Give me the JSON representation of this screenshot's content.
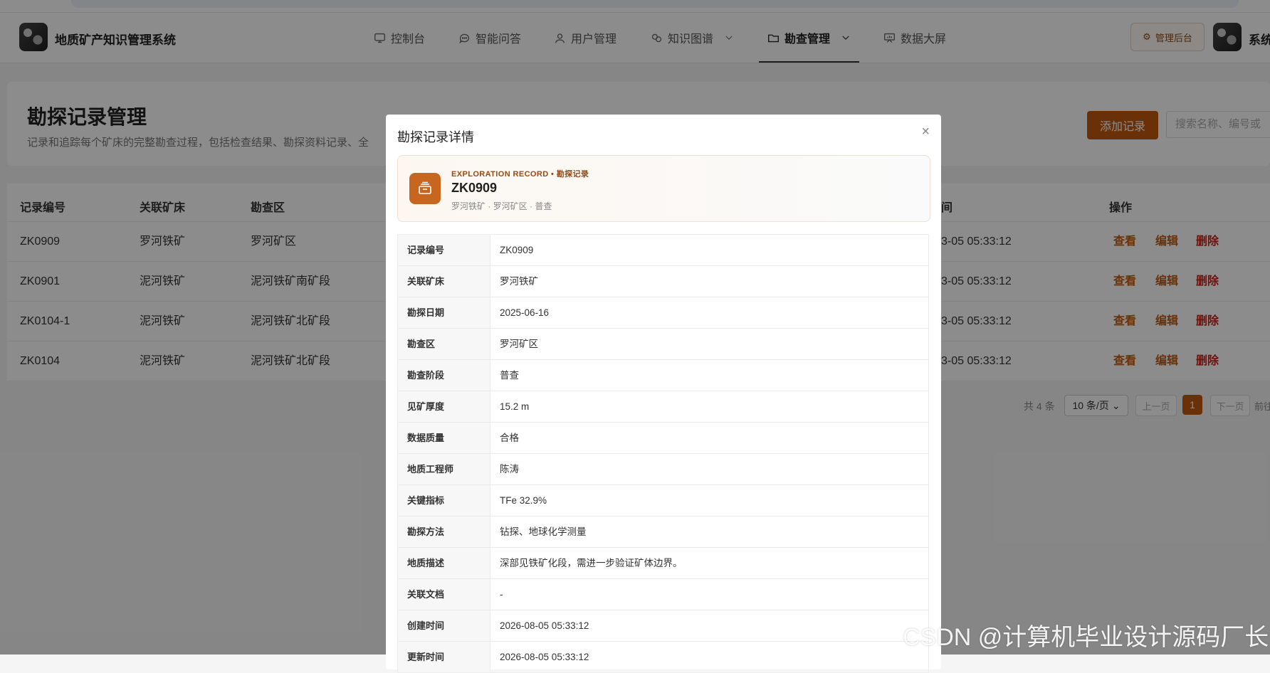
{
  "app": {
    "brand": "地质矿产知识管理系统",
    "admin_label": "管理后台",
    "system_name": "系统"
  },
  "nav": {
    "items": [
      {
        "label": "控制台",
        "icon": "monitor-icon"
      },
      {
        "label": "智能问答",
        "icon": "chat-icon"
      },
      {
        "label": "用户管理",
        "icon": "user-icon"
      },
      {
        "label": "知识图谱",
        "icon": "graph-icon"
      },
      {
        "label": "勘查管理",
        "icon": "folder-icon"
      },
      {
        "label": "数据大屏",
        "icon": "dashboard-icon"
      }
    ],
    "active": "勘查管理"
  },
  "page": {
    "title": "勘探记录管理",
    "description": "记录和追踪每个矿床的完整勘查过程，包括检查结果、勘探资料记录、全",
    "add_button": "添加记录",
    "search_placeholder": "搜索名称、编号或"
  },
  "table": {
    "headers": [
      "记录编号",
      "关联矿床",
      "勘查区",
      "间",
      "操作"
    ],
    "rows": [
      {
        "code": "ZK0909",
        "deposit": "罗河铁矿",
        "area": "罗河矿区",
        "time": "3-05 05:33:12"
      },
      {
        "code": "ZK0901",
        "deposit": "泥河铁矿",
        "area": "泥河铁矿南矿段",
        "time": "3-05 05:33:12"
      },
      {
        "code": "ZK0104-1",
        "deposit": "泥河铁矿",
        "area": "泥河铁矿北矿段",
        "time": "3-05 05:33:12"
      },
      {
        "code": "ZK0104",
        "deposit": "泥河铁矿",
        "area": "泥河铁矿北矿段",
        "time": "3-05 05:33:12"
      }
    ],
    "actions": {
      "view": "查看",
      "edit": "编辑",
      "delete": "删除"
    }
  },
  "pagination": {
    "total": "共 4 条",
    "page_size": "10 条/页",
    "prev": "上一页",
    "current": "1",
    "next": "下一页",
    "jump": "前往"
  },
  "modal": {
    "title": "勘探记录详情",
    "close": "×",
    "kicker": "EXPLORATION RECORD • 勘探记录",
    "code": "ZK0909",
    "subtitle": "罗河铁矿 · 罗河矿区 · 普查",
    "fields": [
      {
        "label": "记录编号",
        "value": "ZK0909"
      },
      {
        "label": "关联矿床",
        "value": "罗河铁矿"
      },
      {
        "label": "勘探日期",
        "value": "2025-06-16"
      },
      {
        "label": "勘查区",
        "value": "罗河矿区"
      },
      {
        "label": "勘查阶段",
        "value": "普查"
      },
      {
        "label": "见矿厚度",
        "value": "15.2 m"
      },
      {
        "label": "数据质量",
        "value": "合格"
      },
      {
        "label": "地质工程师",
        "value": "陈涛"
      },
      {
        "label": "关键指标",
        "value": "TFe 32.9%"
      },
      {
        "label": "勘探方法",
        "value": "钻探、地球化学测量"
      },
      {
        "label": "地质描述",
        "value": "深部见铁矿化段，需进一步验证矿体边界。"
      },
      {
        "label": "关联文档",
        "value": "-"
      },
      {
        "label": "创建时间",
        "value": "2026-08-05 05:33:12"
      },
      {
        "label": "更新时间",
        "value": "2026-08-05 05:33:12"
      }
    ]
  },
  "watermark": "CSDN @计算机毕业设计源码厂长",
  "colors": {
    "accent": "#c25a0f",
    "danger": "#c0231a"
  }
}
